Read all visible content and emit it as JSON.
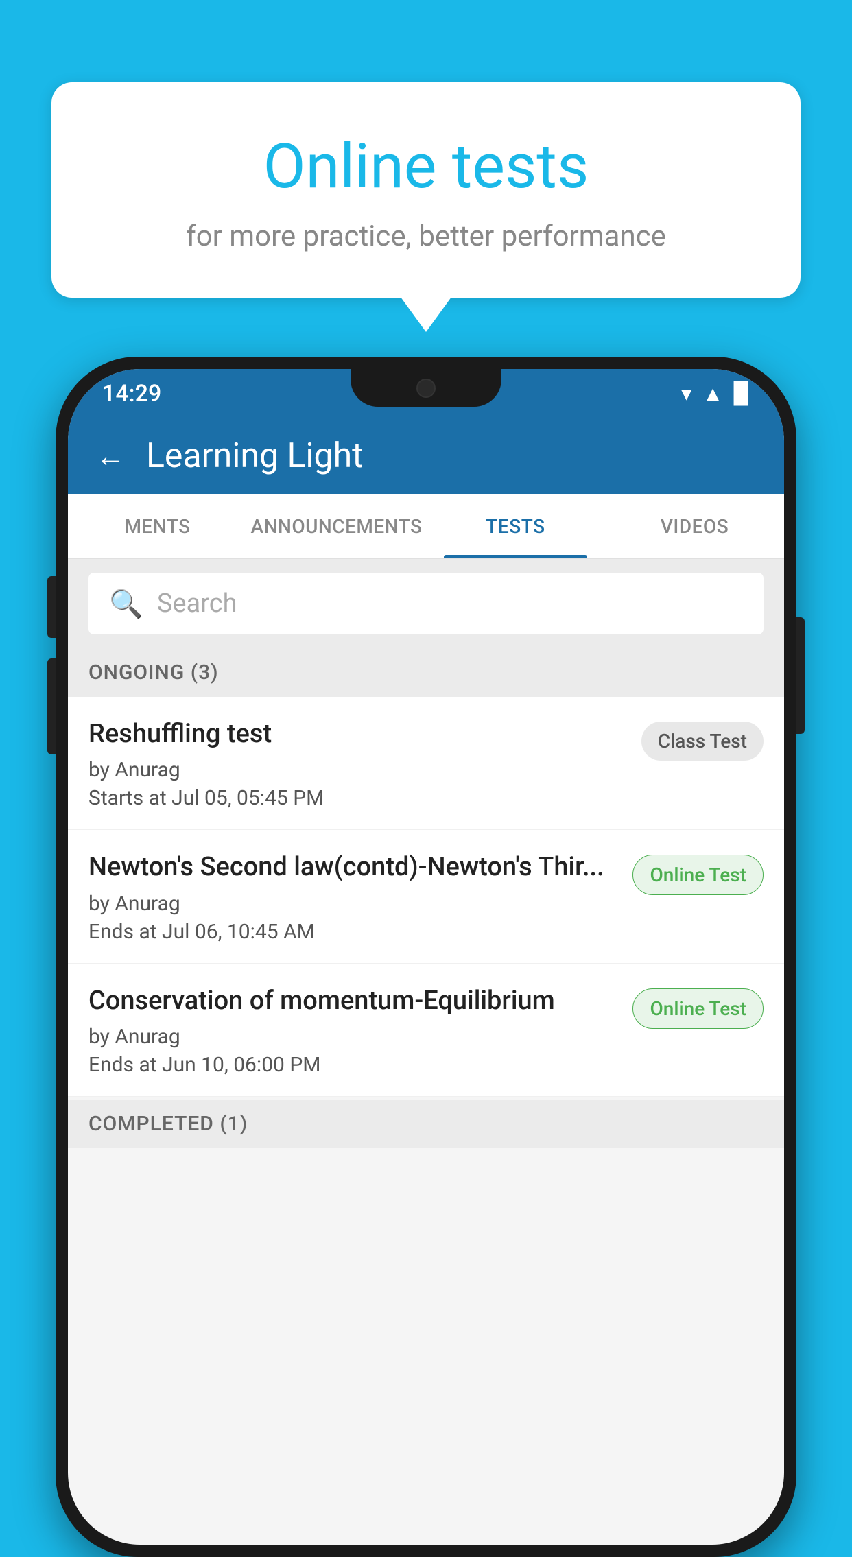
{
  "background": {
    "color": "#1ab8e8"
  },
  "bubble": {
    "title": "Online tests",
    "subtitle": "for more practice, better performance"
  },
  "phone": {
    "status_bar": {
      "time": "14:29"
    },
    "app_bar": {
      "title": "Learning Light",
      "back_label": "←"
    },
    "tabs": [
      {
        "label": "MENTS",
        "active": false
      },
      {
        "label": "ANNOUNCEMENTS",
        "active": false
      },
      {
        "label": "TESTS",
        "active": true
      },
      {
        "label": "VIDEOS",
        "active": false
      }
    ],
    "search": {
      "placeholder": "Search"
    },
    "ongoing_section": {
      "label": "ONGOING (3)"
    },
    "tests": [
      {
        "name": "Reshuffling test",
        "author": "by Anurag",
        "time_label": "Starts at  Jul 05, 05:45 PM",
        "badge": "Class Test",
        "badge_type": "class"
      },
      {
        "name": "Newton's Second law(contd)-Newton's Thir...",
        "author": "by Anurag",
        "time_label": "Ends at  Jul 06, 10:45 AM",
        "badge": "Online Test",
        "badge_type": "online"
      },
      {
        "name": "Conservation of momentum-Equilibrium",
        "author": "by Anurag",
        "time_label": "Ends at  Jun 10, 06:00 PM",
        "badge": "Online Test",
        "badge_type": "online"
      }
    ],
    "completed_section": {
      "label": "COMPLETED (1)"
    }
  }
}
